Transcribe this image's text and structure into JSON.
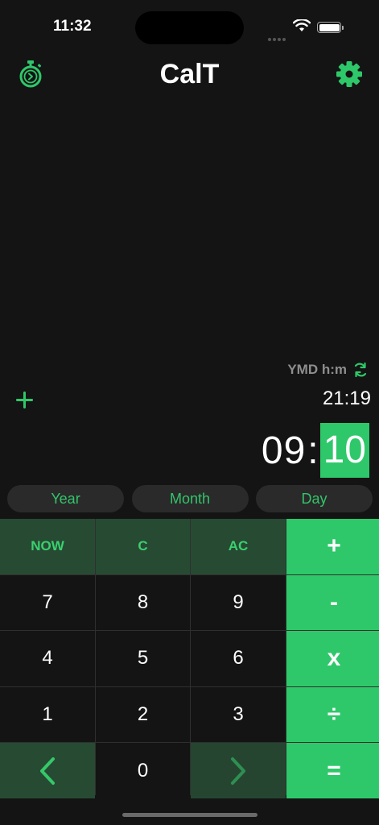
{
  "status_bar": {
    "time": "11:32"
  },
  "header": {
    "title": "CalT"
  },
  "display": {
    "format_label": "YMD h:m",
    "previous_value": "21:19",
    "current_left": "09",
    "separator": ":",
    "current_selected": "10"
  },
  "units": [
    "Year",
    "Month",
    "Day"
  ],
  "keypad": {
    "now": "NOW",
    "clear": "C",
    "all_clear": "AC",
    "plus": "+",
    "minus": "-",
    "multiply": "x",
    "divide": "÷",
    "equals": "=",
    "digits": [
      "0",
      "1",
      "2",
      "3",
      "4",
      "5",
      "6",
      "7",
      "8",
      "9"
    ]
  },
  "colors": {
    "accent": "#2ec86a",
    "function_key_bg": "#274a33",
    "background": "#141414"
  }
}
